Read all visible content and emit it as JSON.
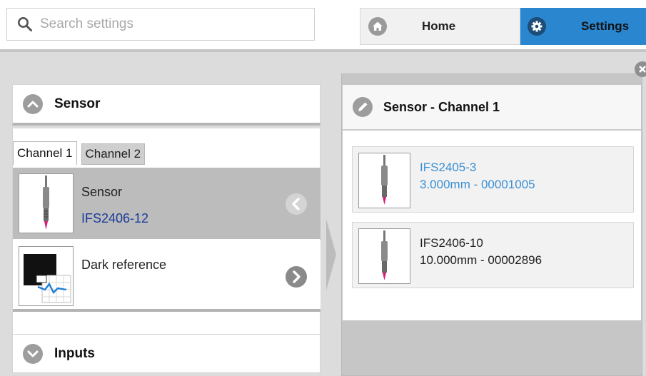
{
  "search": {
    "placeholder": "Search settings"
  },
  "nav": {
    "home_label": "Home",
    "settings_label": "Settings"
  },
  "left": {
    "sensor_section_title": "Sensor",
    "tabs": [
      {
        "label": "Channel 1",
        "active": true
      },
      {
        "label": "Channel 2",
        "active": false
      }
    ],
    "items": [
      {
        "name": "Sensor",
        "value": "IFS2406-12"
      },
      {
        "name": "Dark reference",
        "value": ""
      }
    ],
    "inputs_section_title": "Inputs"
  },
  "right": {
    "title": "Sensor - Channel 1",
    "cards": [
      {
        "name": "IFS2405-3",
        "detail": "3.000mm - 00001005",
        "selected": true
      },
      {
        "name": "IFS2406-10",
        "detail": "10.000mm - 00002896",
        "selected": false
      }
    ]
  },
  "colors": {
    "accent": "#2b86d0",
    "selected_text": "#3a8fd3",
    "value_text": "#1a3b9a"
  }
}
